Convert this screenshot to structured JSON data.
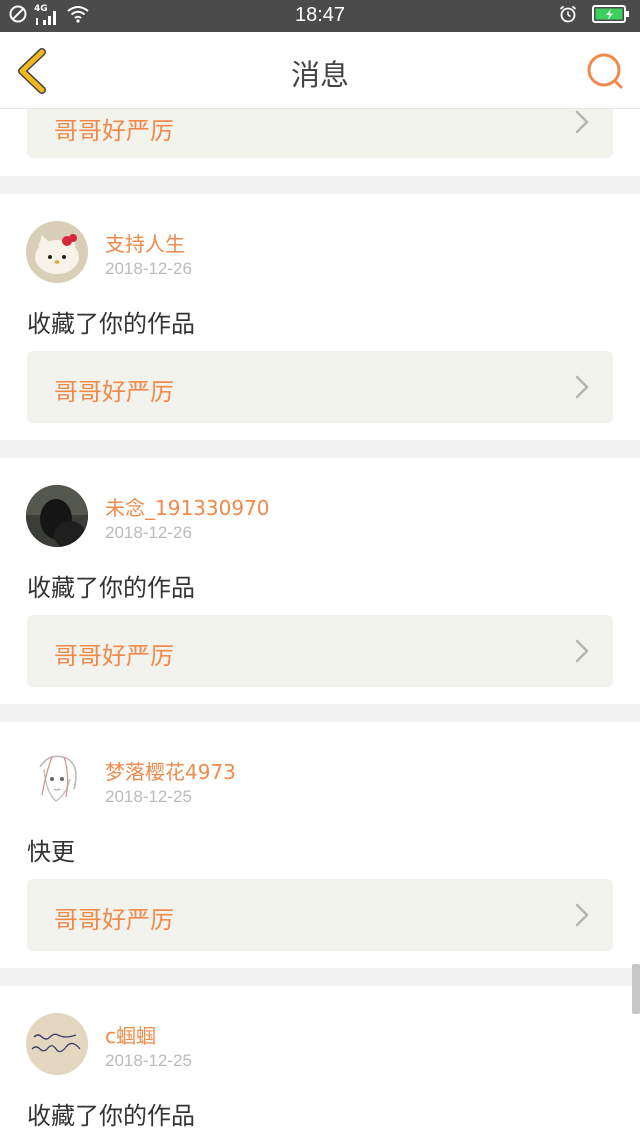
{
  "status_bar": {
    "time": "18:47",
    "network": "4G"
  },
  "header": {
    "title": "消息"
  },
  "top_partial_card": {
    "work_title": "哥哥好严厉"
  },
  "items": [
    {
      "username": "支持人生",
      "date": "2018-12-26",
      "message": "收藏了你的作品",
      "work_title": "哥哥好严厉",
      "avatar": "hello-kitty-avatar"
    },
    {
      "username": "未念_191330970",
      "date": "2018-12-26",
      "message": "收藏了你的作品",
      "work_title": "哥哥好严厉",
      "avatar": "dark-photo-avatar"
    },
    {
      "username": "梦落樱花4973",
      "date": "2018-12-25",
      "message": "快更",
      "work_title": "哥哥好严厉",
      "avatar": "anime-sketch-avatar"
    },
    {
      "username": "c蝈蝈",
      "date": "2018-12-25",
      "message": "收藏了你的作品",
      "avatar": "handwriting-avatar"
    }
  ],
  "colors": {
    "accent": "#f08a4b",
    "back_icon": "#f2b81d",
    "status_bar": "#4b4b4b",
    "battery": "#3cd15e"
  }
}
